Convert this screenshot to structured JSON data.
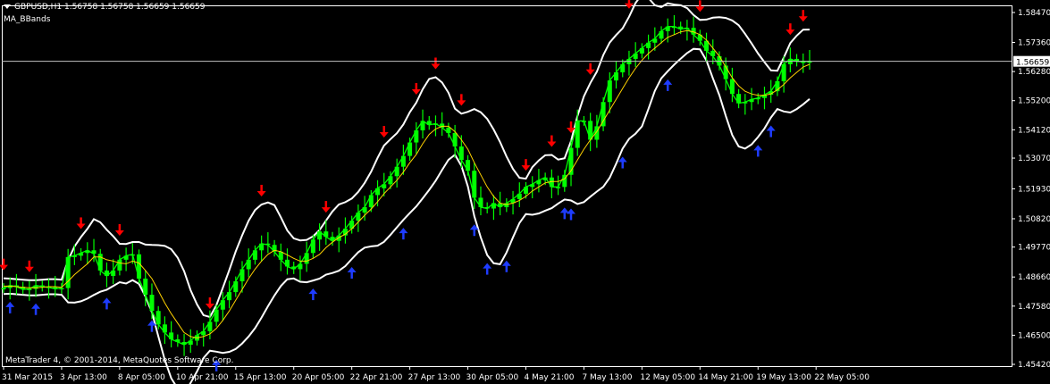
{
  "header": {
    "symbol_line": "GBPUSD,H1  1.56758 1.56758 1.56659 1.56659",
    "indicator": "MA_BBands"
  },
  "footer": {
    "copyright": "MetaTrader 4, © 2001-2014, MetaQuotes Software Corp."
  },
  "current_price_label": "1.56659",
  "colors": {
    "background": "#000000",
    "candles": "#00ff00",
    "bands": "#ffffff",
    "ma": "#ffd200",
    "sell_arrow": "#ff0000",
    "buy_arrow": "#1e3cff",
    "axis": "#ffffff"
  },
  "chart_data": {
    "type": "line",
    "title": "GBPUSD,H1",
    "y_ticks": [
      "1.58470",
      "1.57360",
      "1.56280",
      "1.55200",
      "1.54120",
      "1.53070",
      "1.51930",
      "1.50820",
      "1.49770",
      "1.48660",
      "1.47580",
      "1.46500",
      "1.45420"
    ],
    "ylim": [
      1.4542,
      1.5847
    ],
    "x_labels": [
      "31 Mar 2015",
      "3 Apr 13:00",
      "8 Apr 05:00",
      "10 Apr 21:00",
      "15 Apr 13:00",
      "20 Apr 05:00",
      "22 Apr 21:00",
      "27 Apr 13:00",
      "30 Apr 05:00",
      "4 May 21:00",
      "7 May 13:00",
      "12 May 05:00",
      "14 May 21:00",
      "19 May 13:00",
      "22 May 05:00"
    ],
    "x_label_index": [
      0,
      9,
      18,
      27,
      36,
      45,
      54,
      63,
      72,
      81,
      90,
      99,
      108,
      117,
      126
    ],
    "current_price": 1.56659,
    "series": [
      {
        "name": "Close",
        "values": [
          1.4825,
          1.4835,
          1.483,
          1.482,
          1.4822,
          1.4835,
          1.483,
          1.4828,
          1.4822,
          1.4825,
          1.494,
          1.4945,
          1.4955,
          1.4965,
          1.4952,
          1.489,
          1.487,
          1.489,
          1.493,
          1.4945,
          1.495,
          1.486,
          1.48,
          1.474,
          1.469,
          1.466,
          1.4635,
          1.4625,
          1.4615,
          1.463,
          1.465,
          1.4665,
          1.47,
          1.4745,
          1.478,
          1.481,
          1.485,
          1.4895,
          1.493,
          1.4965,
          1.499,
          1.4985,
          1.496,
          1.493,
          1.4905,
          1.4895,
          1.4915,
          1.4955,
          1.5005,
          1.5035,
          1.5015,
          1.5,
          1.502,
          1.5045,
          1.5075,
          1.5105,
          1.5125,
          1.517,
          1.5195,
          1.521,
          1.524,
          1.5275,
          1.5315,
          1.5365,
          1.541,
          1.5445,
          1.543,
          1.5435,
          1.542,
          1.54,
          1.535,
          1.53,
          1.526,
          1.516,
          1.5125,
          1.512,
          1.514,
          1.5125,
          1.514,
          1.5155,
          1.5175,
          1.52,
          1.521,
          1.5225,
          1.5235,
          1.52,
          1.52,
          1.5245,
          1.5345,
          1.5445,
          1.5445,
          1.5375,
          1.5425,
          1.5515,
          1.5595,
          1.5625,
          1.5655,
          1.5675,
          1.5695,
          1.5715,
          1.5735,
          1.575,
          1.5778,
          1.5795,
          1.5795,
          1.5785,
          1.579,
          1.5765,
          1.5742,
          1.5705,
          1.5685,
          1.565,
          1.56,
          1.5545,
          1.551,
          1.5515,
          1.5525,
          1.553,
          1.5542,
          1.5555,
          1.5592,
          1.5655,
          1.5675,
          1.5665,
          1.5665,
          1.56659
        ]
      },
      {
        "name": "MA",
        "values": [
          1.4832,
          1.4832,
          1.483,
          1.4828,
          1.4826,
          1.4826,
          1.4828,
          1.483,
          1.483,
          1.4828,
          1.485,
          1.4875,
          1.4895,
          1.4915,
          1.494,
          1.494,
          1.493,
          1.4925,
          1.4918,
          1.4915,
          1.4925,
          1.4918,
          1.489,
          1.486,
          1.4815,
          1.477,
          1.473,
          1.4695,
          1.466,
          1.4645,
          1.464,
          1.4645,
          1.4655,
          1.4675,
          1.4705,
          1.474,
          1.478,
          1.482,
          1.486,
          1.4895,
          1.4925,
          1.495,
          1.4965,
          1.496,
          1.4948,
          1.4935,
          1.4925,
          1.4925,
          1.4935,
          1.495,
          1.4975,
          1.4995,
          1.5012,
          1.5025,
          1.5045,
          1.507,
          1.5095,
          1.5118,
          1.5145,
          1.5175,
          1.52,
          1.5225,
          1.5255,
          1.529,
          1.532,
          1.536,
          1.5395,
          1.5415,
          1.5425,
          1.5425,
          1.5405,
          1.5375,
          1.534,
          1.529,
          1.5245,
          1.52,
          1.5165,
          1.514,
          1.5135,
          1.514,
          1.515,
          1.5165,
          1.5185,
          1.52,
          1.5215,
          1.522,
          1.522,
          1.523,
          1.526,
          1.53,
          1.534,
          1.5375,
          1.5405,
          1.5445,
          1.5485,
          1.5525,
          1.5565,
          1.5605,
          1.564,
          1.567,
          1.5695,
          1.5715,
          1.5735,
          1.5755,
          1.5765,
          1.5775,
          1.578,
          1.5775,
          1.5765,
          1.5745,
          1.5715,
          1.5685,
          1.5645,
          1.5605,
          1.5575,
          1.5555,
          1.5545,
          1.554,
          1.554,
          1.5545,
          1.556,
          1.558,
          1.5605,
          1.5625,
          1.5645,
          1.5655
        ]
      }
    ],
    "sell_signals": [
      0,
      4,
      12,
      18,
      32,
      40,
      50,
      59,
      64,
      67,
      71,
      81,
      85,
      88,
      91,
      97,
      101,
      104,
      108,
      122,
      124
    ],
    "buy_signals": [
      1,
      5,
      16,
      23,
      26,
      29,
      33,
      48,
      54,
      62,
      73,
      75,
      78,
      87,
      88,
      96,
      103,
      117,
      119
    ]
  }
}
